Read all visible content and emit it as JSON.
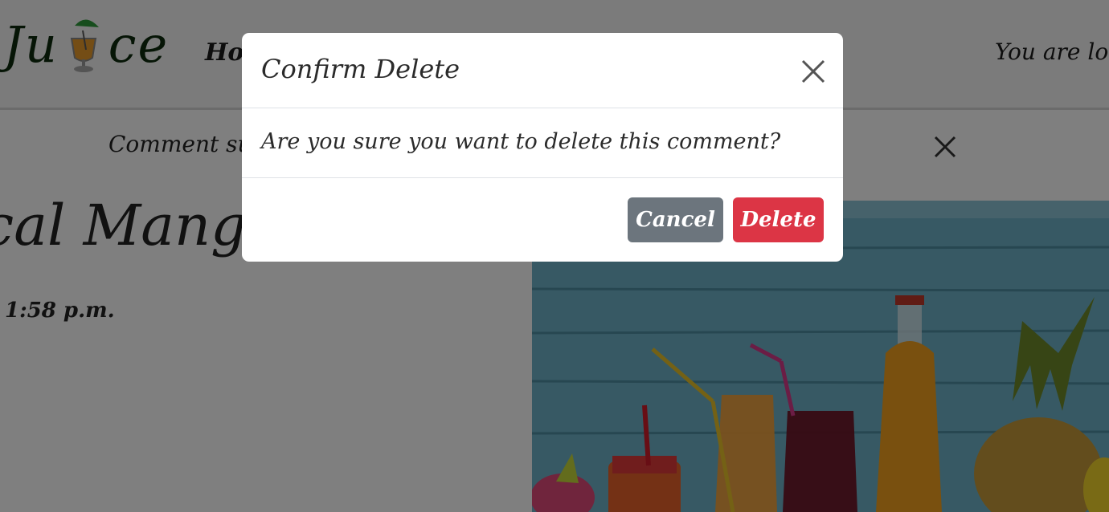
{
  "navbar": {
    "brand_prefix": "Ju",
    "brand_suffix": "ce",
    "brand_icon": "tropical-drink-icon",
    "nav_link": "Hor",
    "login_status": "You are log"
  },
  "alert": {
    "text": "Comment sub",
    "close_icon": "close-icon"
  },
  "post": {
    "title": "cal Mango",
    "time": "1:58 p.m."
  },
  "modal": {
    "title": "Confirm Delete",
    "message": "Are you sure you want to delete this comment?",
    "cancel_label": "Cancel",
    "delete_label": "Delete",
    "close_icon": "close-icon"
  },
  "colors": {
    "cancel": "#6c757d",
    "delete": "#dc3545",
    "backdrop": "rgba(0,0,0,0.5)"
  }
}
